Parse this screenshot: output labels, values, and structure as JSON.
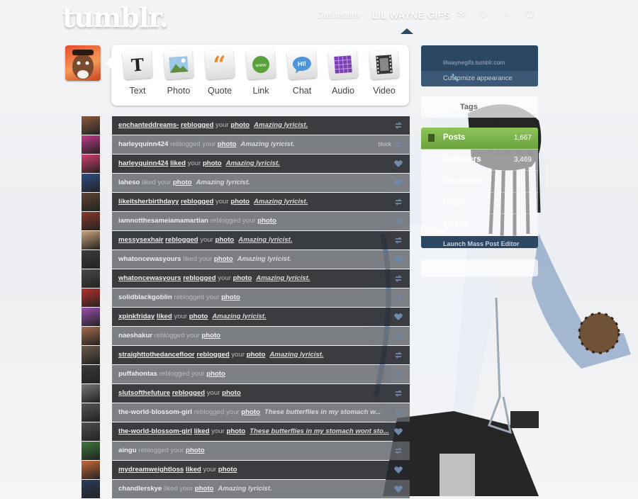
{
  "header": {
    "logo": "tumblr.",
    "nav_dashboard": "Dashboard",
    "nav_blog": "LIL WAYNE GIFS",
    "icons": [
      "mail-icon",
      "person-icon",
      "search-icon",
      "power-icon"
    ]
  },
  "post_types": [
    {
      "label": "Text",
      "icon": "text-icon"
    },
    {
      "label": "Photo",
      "icon": "photo-icon"
    },
    {
      "label": "Quote",
      "icon": "quote-icon"
    },
    {
      "label": "Link",
      "icon": "link-icon"
    },
    {
      "label": "Chat",
      "icon": "chat-icon"
    },
    {
      "label": "Audio",
      "icon": "audio-icon"
    },
    {
      "label": "Video",
      "icon": "video-icon"
    }
  ],
  "activity": [
    {
      "user": "enchanteddreams-",
      "action": "reblogged",
      "post": "photo",
      "quote": "Amazing lyricist.",
      "style": "dark",
      "icon": "reblog-icon",
      "avatar": "#8a5a3c"
    },
    {
      "user": "harleyquinn424",
      "action": "reblogged",
      "post": "photo",
      "quote": "Amazing lyricist.",
      "style": "light",
      "icon": "reblog-icon",
      "extra": "block",
      "avatar": "#c23a8c"
    },
    {
      "user": "harleyquinn424",
      "action": "liked",
      "post": "photo",
      "quote": "Amazing lyricist.",
      "style": "dark",
      "icon": "heart-icon",
      "avatar": "#d43f6e"
    },
    {
      "user": "laheso",
      "action": "liked",
      "post": "photo",
      "quote": "Amazing lyricist.",
      "style": "light",
      "icon": "heart-icon",
      "avatar": "#2f4f86"
    },
    {
      "user": "likeitsherbirthdayy",
      "action": "reblogged",
      "post": "photo",
      "quote": "Amazing lyricist.",
      "style": "dark",
      "icon": "reblog-icon",
      "avatar": "#5d4534"
    },
    {
      "user": "iamnotthesameiamamartian",
      "action": "reblogged",
      "post": "photo",
      "quote": "",
      "style": "light",
      "icon": "reblog-icon",
      "avatar": "#8b3a2a"
    },
    {
      "user": "messysexhair",
      "action": "reblogged",
      "post": "photo",
      "quote": "Amazing lyricist.",
      "style": "dark",
      "icon": "reblog-icon",
      "avatar": "#c8a27a"
    },
    {
      "user": "whatoncewasyours",
      "action": "liked",
      "post": "photo",
      "quote": "Amazing lyricist.",
      "style": "light",
      "icon": "heart-icon",
      "avatar": "#3d3d3d"
    },
    {
      "user": "whatoncewasyours",
      "action": "reblogged",
      "post": "photo",
      "quote": "Amazing lyricist.",
      "style": "dark",
      "icon": "reblog-icon",
      "avatar": "#4a4a4a"
    },
    {
      "user": "solidblackgoblin",
      "action": "reblogged",
      "post": "photo",
      "quote": "",
      "style": "light",
      "icon": "reblog-icon",
      "avatar": "#b8322c"
    },
    {
      "user": "xpinkfriday",
      "action": "liked",
      "post": "photo",
      "quote": "Amazing lyricist.",
      "style": "dark",
      "icon": "heart-icon",
      "avatar": "#9b4fb0"
    },
    {
      "user": "naeshakur",
      "action": "reblogged",
      "post": "photo",
      "quote": "",
      "style": "light",
      "icon": "reblog-icon",
      "avatar": "#a86c4c"
    },
    {
      "user": "straighttothedancefloor",
      "action": "reblogged",
      "post": "photo",
      "quote": "Amazing lyricist.",
      "style": "dark",
      "icon": "reblog-icon",
      "avatar": "#6b5a49"
    },
    {
      "user": "puffahontas",
      "action": "reblogged",
      "post": "photo",
      "quote": "",
      "style": "light",
      "icon": "reblog-icon",
      "avatar": "#3a3a3a"
    },
    {
      "user": "slutsofthefuture",
      "action": "reblogged",
      "post": "photo",
      "quote": "",
      "style": "dark",
      "icon": "reblog-icon",
      "avatar": "#777777"
    },
    {
      "user": "the-world-blossom-girl",
      "action": "reblogged",
      "post": "photo",
      "quote": "These butterflies in my stomach w...",
      "style": "light",
      "icon": "reblog-icon",
      "avatar": "#555555"
    },
    {
      "user": "the-world-blossom-girl",
      "action": "liked",
      "post": "photo",
      "quote": "These butterflies in my stomach wont sto...",
      "style": "dark",
      "icon": "heart-icon",
      "avatar": "#4f4f4f"
    },
    {
      "user": "aingu",
      "action": "reblogged",
      "post": "photo",
      "quote": "",
      "style": "light",
      "icon": "reblog-icon",
      "avatar": "#3c7a3a"
    },
    {
      "user": "mydreamweightloss",
      "action": "liked",
      "post": "photo",
      "quote": "",
      "style": "dark",
      "icon": "heart-icon",
      "avatar": "#c96a3a"
    },
    {
      "user": "chandlerskye",
      "action": "liked",
      "post": "photo",
      "quote": "Amazing lyricist.",
      "style": "light",
      "icon": "heart-icon",
      "avatar": "#2a3d5c"
    }
  ],
  "sidebar": {
    "blog_url": "lilwaynegifs.tumblr.com",
    "customize": "Customize appearance",
    "tags_label": "Tags",
    "menu": [
      {
        "label": "Posts",
        "count": "1,667",
        "active": true
      },
      {
        "label": "Followers",
        "count": "3,469",
        "active": false
      },
      {
        "label": "Messages",
        "count": "",
        "active": false
      },
      {
        "label": "Drafts",
        "count": "",
        "active": false
      },
      {
        "label": "Queue",
        "count": "",
        "active": false
      }
    ],
    "mass_editor": "Launch Mass Post Editor"
  },
  "colors": {
    "accent_blue": "#2c4762",
    "active_green": "#7ab34a"
  }
}
